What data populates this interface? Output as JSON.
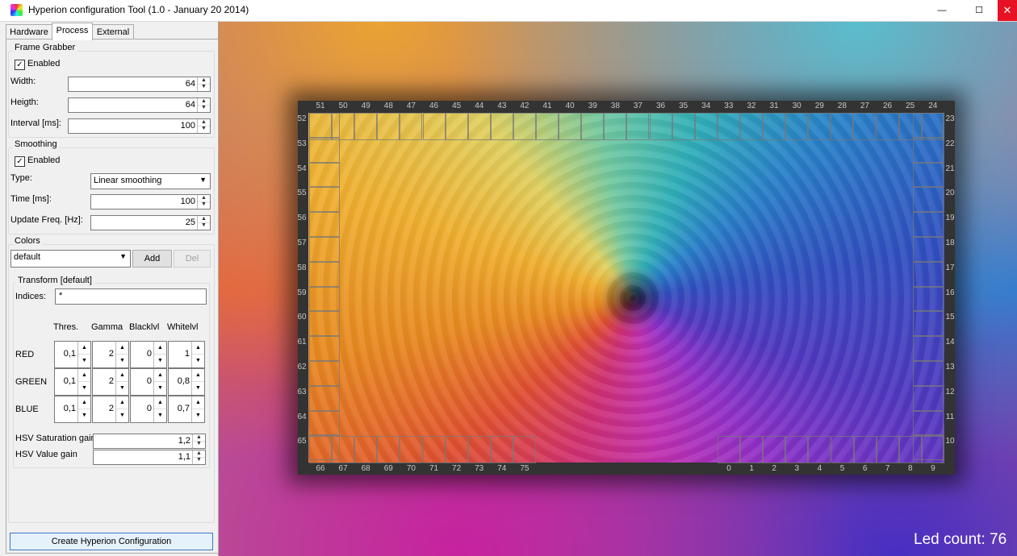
{
  "window": {
    "title": "Hyperion configuration Tool (1.0 - January 20 2014)",
    "minimize": "—",
    "maximize": "☐",
    "close": "✕"
  },
  "tabs": [
    {
      "label": "Hardware"
    },
    {
      "label": "Process",
      "active": true
    },
    {
      "label": "External"
    }
  ],
  "frame_grabber": {
    "title": "Frame Grabber",
    "enabled_label": "Enabled",
    "enabled": true,
    "width_label": "Width:",
    "width": "64",
    "height_label": "Heigth:",
    "height": "64",
    "interval_label": "Interval [ms]:",
    "interval": "100"
  },
  "smoothing": {
    "title": "Smoothing",
    "enabled_label": "Enabled",
    "enabled": true,
    "type_label": "Type:",
    "type": "Linear smoothing",
    "time_label": "Time [ms]:",
    "time": "100",
    "update_label": "Update Freq. [Hz]:",
    "update": "25"
  },
  "colors": {
    "title": "Colors",
    "selected": "default",
    "add": "Add",
    "del": "Del",
    "transform_title": "Transform [default]",
    "indices_label": "Indices:",
    "indices": "*",
    "headers": [
      "Thres.",
      "Gamma",
      "Blacklvl",
      "Whitelvl"
    ],
    "rows": [
      {
        "label": "RED",
        "values": [
          "0,1",
          "2",
          "0",
          "1"
        ]
      },
      {
        "label": "GREEN",
        "values": [
          "0,1",
          "2",
          "0",
          "0,8"
        ]
      },
      {
        "label": "BLUE",
        "values": [
          "0,1",
          "2",
          "0",
          "0,7"
        ]
      }
    ],
    "hsv_sat_label": "HSV Saturation gain",
    "hsv_sat": "1,2",
    "hsv_val_label": "HSV Value gain",
    "hsv_val": "1,1"
  },
  "create_button": "Create Hyperion Configuration",
  "led_count": "Led count: 76",
  "leds": {
    "top": [
      "51",
      "50",
      "49",
      "48",
      "47",
      "46",
      "45",
      "44",
      "43",
      "42",
      "41",
      "40",
      "39",
      "38",
      "37",
      "36",
      "35",
      "34",
      "33",
      "32",
      "31",
      "30",
      "29",
      "28",
      "27",
      "26",
      "25",
      "24"
    ],
    "left": [
      "52",
      "53",
      "54",
      "55",
      "56",
      "57",
      "58",
      "59",
      "60",
      "61",
      "62",
      "63",
      "64",
      "65"
    ],
    "right": [
      "23",
      "22",
      "21",
      "20",
      "19",
      "18",
      "17",
      "16",
      "15",
      "14",
      "13",
      "12",
      "11",
      "10"
    ],
    "bottom_left": [
      "66",
      "67",
      "68",
      "69",
      "70",
      "71",
      "72",
      "73",
      "74",
      "75"
    ],
    "bottom_right": [
      "0",
      "1",
      "2",
      "3",
      "4",
      "5",
      "6",
      "7",
      "8",
      "9"
    ]
  }
}
